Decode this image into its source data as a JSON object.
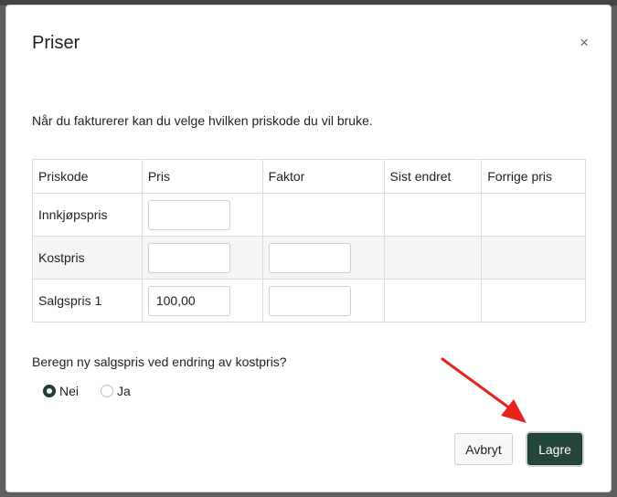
{
  "modal": {
    "title": "Priser",
    "close_symbol": "×",
    "intro": "Når du fakturerer kan du velge hvilken priskode du vil bruke."
  },
  "table": {
    "headers": [
      "Priskode",
      "Pris",
      "Faktor",
      "Sist endret",
      "Forrige pris"
    ],
    "rows": [
      {
        "code": "Innkjøpspris",
        "pris": "",
        "faktor": null,
        "sist_endret": "",
        "forrige_pris": ""
      },
      {
        "code": "Kostpris",
        "pris": "",
        "faktor": "",
        "sist_endret": "",
        "forrige_pris": ""
      },
      {
        "code": "Salgspris 1",
        "pris": "100,00",
        "faktor": "",
        "sist_endret": "",
        "forrige_pris": ""
      }
    ]
  },
  "recalc": {
    "question": "Beregn ny salgspris ved endring av kostpris?",
    "options": [
      {
        "label": "Nei",
        "selected": true
      },
      {
        "label": "Ja",
        "selected": false
      }
    ]
  },
  "buttons": {
    "cancel_label": "Avbryt",
    "save_label": "Lagre"
  },
  "colors": {
    "primary": "#24453a",
    "annotation_arrow": "#e8231c"
  },
  "icons": {
    "close": "close-icon",
    "annotation": "red-arrow-icon"
  }
}
